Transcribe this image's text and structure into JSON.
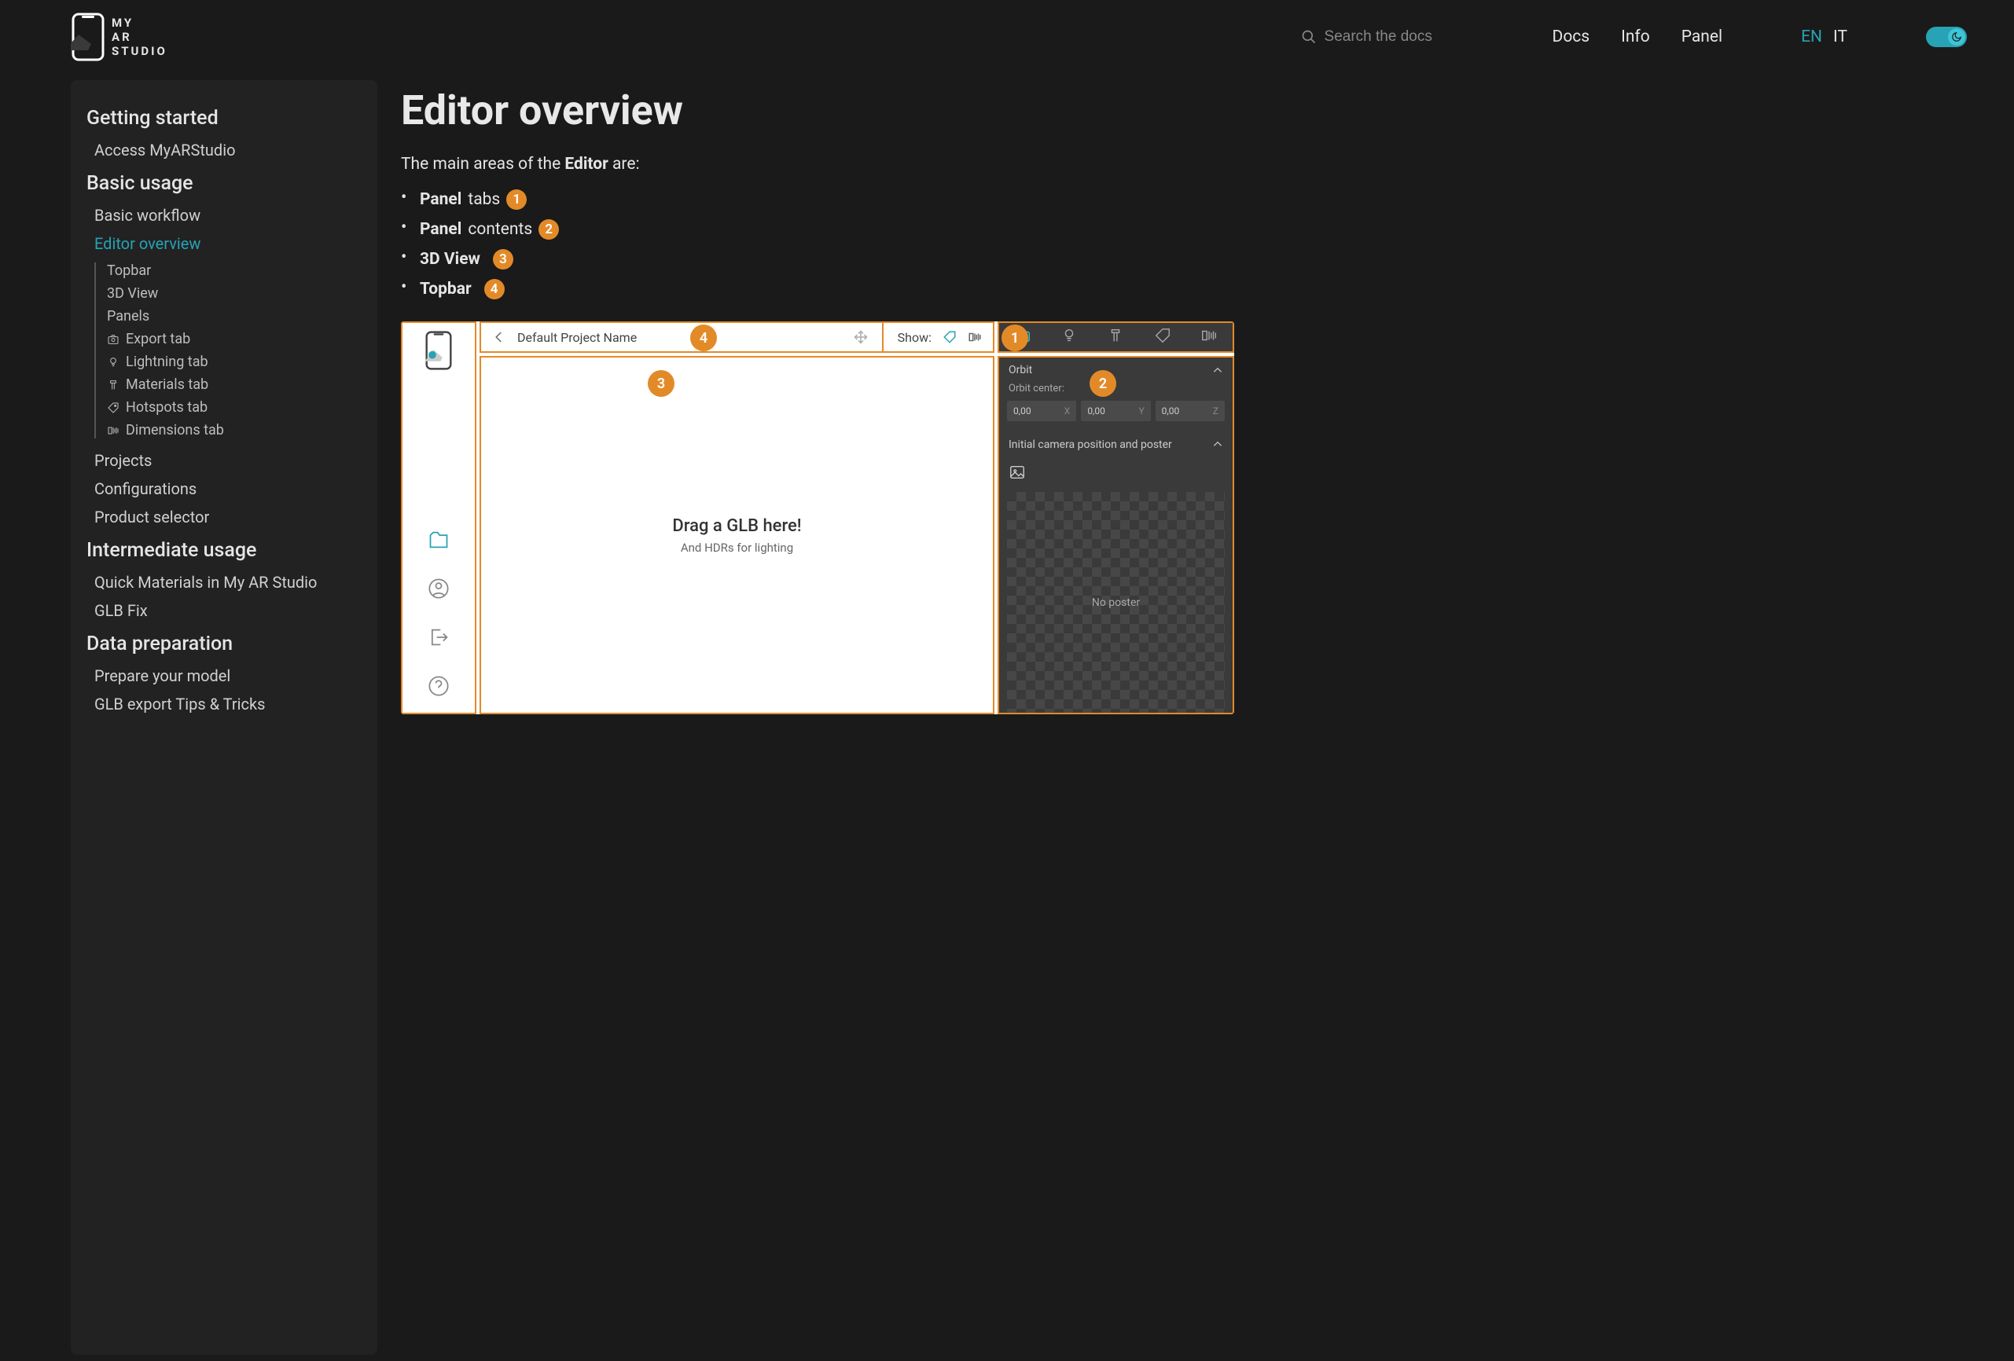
{
  "brand": {
    "line1": "MY",
    "line2": "AR",
    "line3": "STUDIO"
  },
  "search": {
    "placeholder": "Search the docs"
  },
  "nav": {
    "docs": "Docs",
    "info": "Info",
    "panel": "Panel"
  },
  "lang": {
    "en": "EN",
    "it": "IT"
  },
  "sidebar": {
    "s0": "Getting started",
    "i0": "Access MyARStudio",
    "s1": "Basic usage",
    "i1": "Basic workflow",
    "i2": "Editor overview",
    "sub": {
      "topbar": "Topbar",
      "view3d": "3D View",
      "panels": "Panels",
      "export": "Export tab",
      "light": "Lightning tab",
      "mat": "Materials tab",
      "hot": "Hotspots tab",
      "dim": "Dimensions tab"
    },
    "i3": "Projects",
    "i4": "Configurations",
    "i5": "Product selector",
    "s2": "Intermediate usage",
    "i6": "Quick Materials in My AR Studio",
    "i7": "GLB Fix",
    "s3": "Data preparation",
    "i8": "Prepare your model",
    "i9": "GLB export Tips & Tricks"
  },
  "page": {
    "title": "Editor overview",
    "intro_pre": "The main areas of the ",
    "intro_bold": "Editor",
    "intro_post": " are:",
    "bullets": [
      {
        "bold": "Panel",
        "rest": " tabs ",
        "num": "1"
      },
      {
        "bold": "Panel",
        "rest": " contents ",
        "num": "2"
      },
      {
        "bold": "3D View",
        "rest": " ",
        "num": "3"
      },
      {
        "bold": "Topbar",
        "rest": " ",
        "num": "4"
      }
    ]
  },
  "mock": {
    "project": "Default Project Name",
    "show": "Show:",
    "drag": "Drag a GLB here!",
    "dragsub": "And HDRs for lighting",
    "orbit": "Orbit",
    "orbit_center": "Orbit center:",
    "f0": "0,00",
    "a0": "X",
    "f1": "0,00",
    "a1": "Y",
    "f2": "0,00",
    "a2": "Z",
    "camera": "Initial camera position and poster",
    "noposter": "No poster",
    "b1": "1",
    "b2": "2",
    "b3": "3",
    "b4": "4"
  }
}
